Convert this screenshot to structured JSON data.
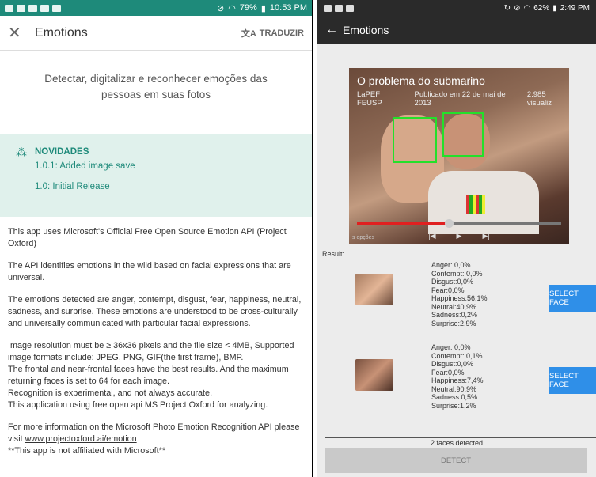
{
  "left": {
    "status": {
      "battery": "79%",
      "time": "10:53 PM"
    },
    "appbar": {
      "title": "Emotions",
      "translate_label": "TRADUZIR"
    },
    "description": "Detectar, digitalizar e reconhecer emoções das pessoas em suas fotos",
    "news": {
      "heading": "NOVIDADES",
      "items": [
        "1.0.1: Added image save",
        "1.0: Initial Release"
      ]
    },
    "paragraphs": [
      "This app uses Microsoft's Official Free Open Source Emotion API (Project Oxford)",
      "The API identifies emotions in the wild based on facial expressions that are universal.",
      "The emotions detected are anger, contempt, disgust, fear, happiness, neutral, sadness, and surprise. These emotions are understood to be cross-culturally and universally communicated with particular facial expressions."
    ],
    "resolution_lines": [
      "Image resolution must be ≥ 36x36 pixels and the file size < 4MB, Supported image formats include: JPEG, PNG, GIF(the first frame), BMP.",
      "The frontal and near-frontal faces have the best results. And the maximum returning faces is set to 64 for each image.",
      "Recognition is experimental, and not always accurate.",
      "This application using free open api MS Project Oxford for analyzing."
    ],
    "more_info_prefix": "For more information on the Microsoft Photo Emotion Recognition API please visit ",
    "more_info_link": "www.projectoxford.ai/emotion",
    "disclaimer": "**This app is not affiliated with Microsoft**"
  },
  "right": {
    "status": {
      "battery": "62%",
      "time": "2:49 PM"
    },
    "appbar": {
      "title": "Emotions"
    },
    "video": {
      "title": "O problema do submarino",
      "channel": "LaPEF FEUSP",
      "published": "Publicado em 22 de mai de 2013",
      "views": "2.985 visualiz",
      "options": "s opções",
      "progress": 0.45
    },
    "result_label": "Result:",
    "faces": [
      {
        "stats": [
          "Anger: 0,0%",
          "Contempt: 0,0%",
          "Disgust:0,0%",
          "Fear:0,0%",
          "Happiness:56,1%",
          "Neutral:40,9%",
          "Sadness:0,2%",
          "Surprise:2,9%"
        ],
        "button": "SELECT FACE"
      },
      {
        "stats": [
          "Anger: 0,0%",
          "Contempt: 0,1%",
          "Disgust:0,0%",
          "Fear:0,0%",
          "Happiness:7,4%",
          "Neutral:90,9%",
          "Sadness:0,5%",
          "Surprise:1,2%"
        ],
        "button": "SELECT FACE"
      }
    ],
    "faces_detected": "2 faces detected",
    "detect_label": "DETECT"
  }
}
